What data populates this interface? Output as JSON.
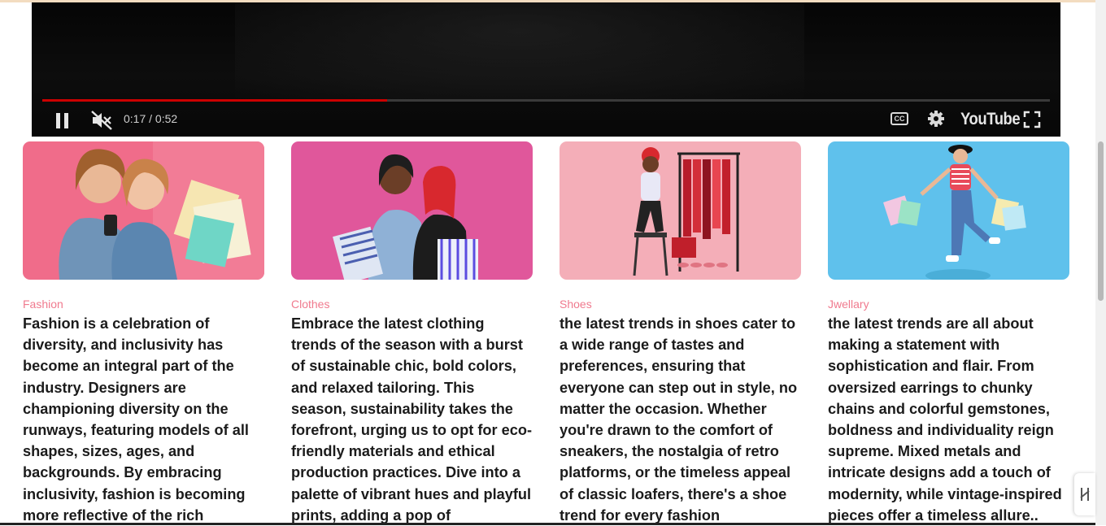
{
  "player": {
    "time": "0:17 / 0:52",
    "brand": "YouTube",
    "progress_fraction": 0.342,
    "progress_color": "#cc0000",
    "icons": [
      "pause-icon",
      "mute-icon",
      "cc-icon",
      "gear-icon",
      "fullscreen-icon"
    ]
  },
  "cards": [
    {
      "category": "Fashion",
      "text": "Fashion is a celebration of diversity, and inclusivity has become an integral part of the industry. Designers are championing diversity on the runways, featuring models of all shapes, sizes, ages, and backgrounds. By embracing inclusivity, fashion is becoming more reflective of the rich"
    },
    {
      "category": "Clothes",
      "text": "Embrace the latest clothing trends of the season with a burst of sustainable chic, bold colors, and relaxed tailoring. This season, sustainability takes the forefront, urging us to opt for eco-friendly materials and ethical production practices. Dive into a palette of vibrant hues and playful prints, adding a pop of"
    },
    {
      "category": "Shoes",
      "text": "the latest trends in shoes cater to a wide range of tastes and preferences, ensuring that everyone can step out in style, no matter the occasion. Whether you're drawn to the comfort of sneakers, the nostalgia of retro platforms, or the timeless appeal of classic loafers, there's a shoe trend for every fashion"
    },
    {
      "category": "Jwellary",
      "text": "the latest trends are all about making a statement with sophistication and flair. From oversized earrings to chunky chains and colorful gemstones, boldness and individuality reign supreme. Mixed metals and intricate designs add a touch of modernity, while vintage-inspired pieces offer a timeless allure.."
    }
  ],
  "colors": {
    "category": "#f07a8e",
    "text": "#1b1b1b"
  }
}
